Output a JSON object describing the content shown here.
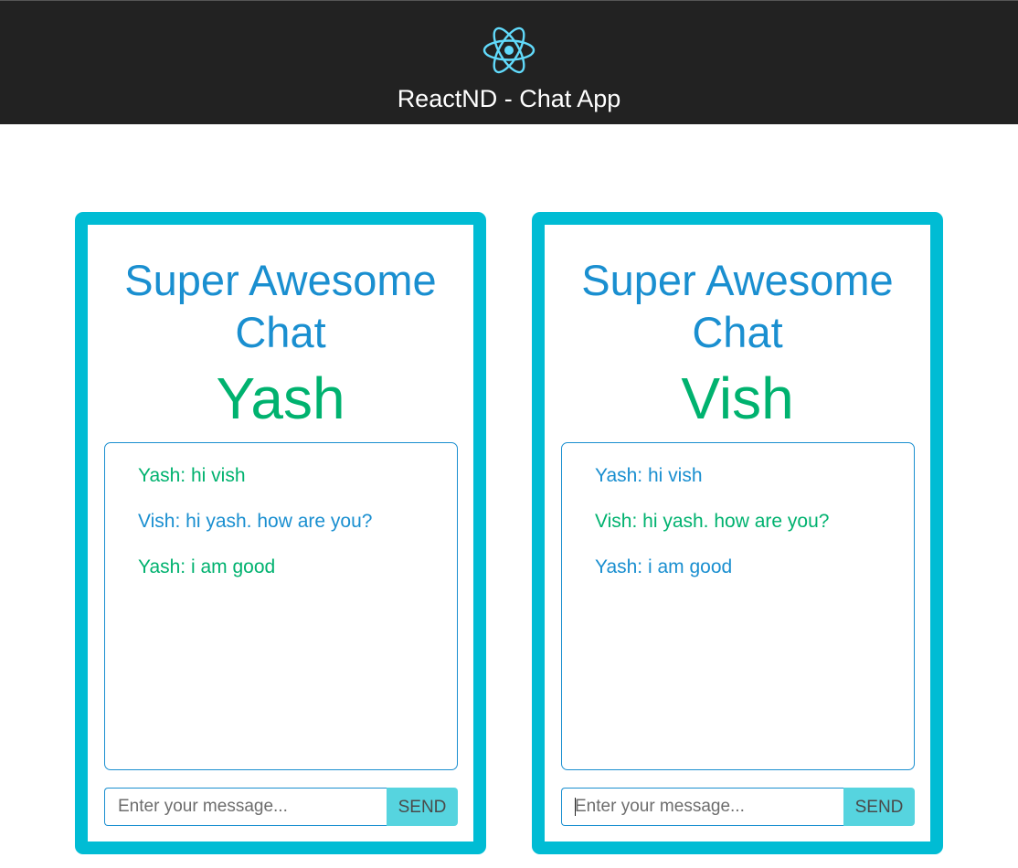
{
  "header": {
    "title": "ReactND - Chat App",
    "logo_icon": "react-atom-icon",
    "logo_color": "#61dafb"
  },
  "colors": {
    "header_bg": "#222222",
    "panel_border": "#00bcd4",
    "title_blue": "#1a8fd0",
    "own_green": "#00b26f",
    "send_bg": "#56d4df"
  },
  "chats": [
    {
      "title": "Super Awesome Chat",
      "user": "Yash",
      "messages": [
        {
          "text": "Yash: hi vish",
          "own": true
        },
        {
          "text": "Vish: hi yash. how are you?",
          "own": false
        },
        {
          "text": "Yash: i am good",
          "own": true
        }
      ],
      "input_placeholder": "Enter your message...",
      "input_value": "",
      "send_label": "SEND"
    },
    {
      "title": "Super Awesome Chat",
      "user": "Vish",
      "messages": [
        {
          "text": "Yash: hi vish",
          "own": false
        },
        {
          "text": "Vish: hi yash. how are you?",
          "own": true
        },
        {
          "text": "Yash: i am good",
          "own": false
        }
      ],
      "input_placeholder": "Enter your message...",
      "input_value": "",
      "send_label": "SEND"
    }
  ]
}
